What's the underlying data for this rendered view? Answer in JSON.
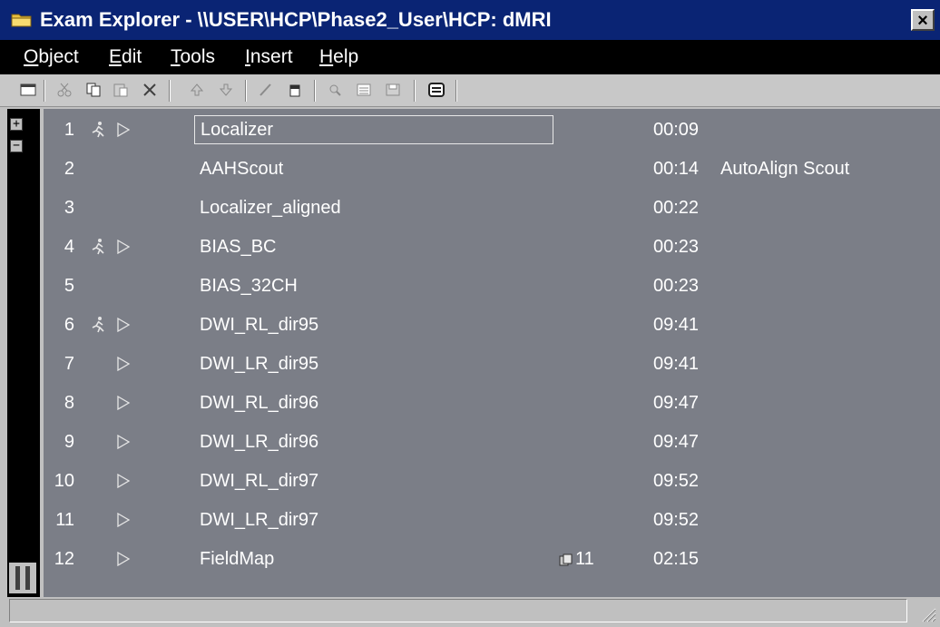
{
  "window": {
    "title": "Exam Explorer - \\\\USER\\HCP\\Phase2_User\\HCP: dMRI",
    "close_glyph": "×"
  },
  "menu": [
    {
      "first": "O",
      "rest": "bject"
    },
    {
      "first": "E",
      "rest": "dit"
    },
    {
      "first": "T",
      "rest": "ools"
    },
    {
      "first": "I",
      "rest": "nsert"
    },
    {
      "first": "H",
      "rest": "elp"
    }
  ],
  "tree": {
    "expand_glyph": "+",
    "collapse_glyph": "−"
  },
  "rows": [
    {
      "num": "1",
      "name": "Localizer",
      "time": "00:09",
      "comment": "",
      "series": "",
      "runner": true,
      "play": true
    },
    {
      "num": "2",
      "name": "AAHScout",
      "time": "00:14",
      "comment": "AutoAlign Scout",
      "series": "",
      "runner": false,
      "play": false
    },
    {
      "num": "3",
      "name": "Localizer_aligned",
      "time": "00:22",
      "comment": "",
      "series": "",
      "runner": false,
      "play": false
    },
    {
      "num": "4",
      "name": "BIAS_BC",
      "time": "00:23",
      "comment": "",
      "series": "",
      "runner": true,
      "play": true
    },
    {
      "num": "5",
      "name": "BIAS_32CH",
      "time": "00:23",
      "comment": "",
      "series": "",
      "runner": false,
      "play": false
    },
    {
      "num": "6",
      "name": "DWI_RL_dir95",
      "time": "09:41",
      "comment": "",
      "series": "",
      "runner": true,
      "play": true
    },
    {
      "num": "7",
      "name": "DWI_LR_dir95",
      "time": "09:41",
      "comment": "",
      "series": "",
      "runner": false,
      "play": true
    },
    {
      "num": "8",
      "name": "DWI_RL_dir96",
      "time": "09:47",
      "comment": "",
      "series": "",
      "runner": false,
      "play": true
    },
    {
      "num": "9",
      "name": "DWI_LR_dir96",
      "time": "09:47",
      "comment": "",
      "series": "",
      "runner": false,
      "play": true
    },
    {
      "num": "10",
      "name": "DWI_RL_dir97",
      "time": "09:52",
      "comment": "",
      "series": "",
      "runner": false,
      "play": true
    },
    {
      "num": "11",
      "name": "DWI_LR_dir97",
      "time": "09:52",
      "comment": "",
      "series": "",
      "runner": false,
      "play": true
    },
    {
      "num": "12",
      "name": "FieldMap",
      "time": "02:15",
      "comment": "",
      "series": "11",
      "runner": false,
      "play": true
    }
  ],
  "selected_row": "1",
  "colors": {
    "titlebar": "#0a2474",
    "menubar": "#000000",
    "list_background": "#7b7e87",
    "list_text": "#ffffff",
    "chrome": "#c0c0c0"
  },
  "icons": {
    "app": "folder-icon",
    "toolbar": [
      "view-icon",
      "cut-icon",
      "copy-icon",
      "paste-icon",
      "delete-icon",
      "move-up-icon",
      "move-down-icon",
      "edit-icon",
      "properties-icon",
      "search-icon",
      "list-icon",
      "save-icon",
      "display-icon"
    ],
    "row": [
      "runner-icon",
      "play-icon",
      "series-icon"
    ]
  }
}
